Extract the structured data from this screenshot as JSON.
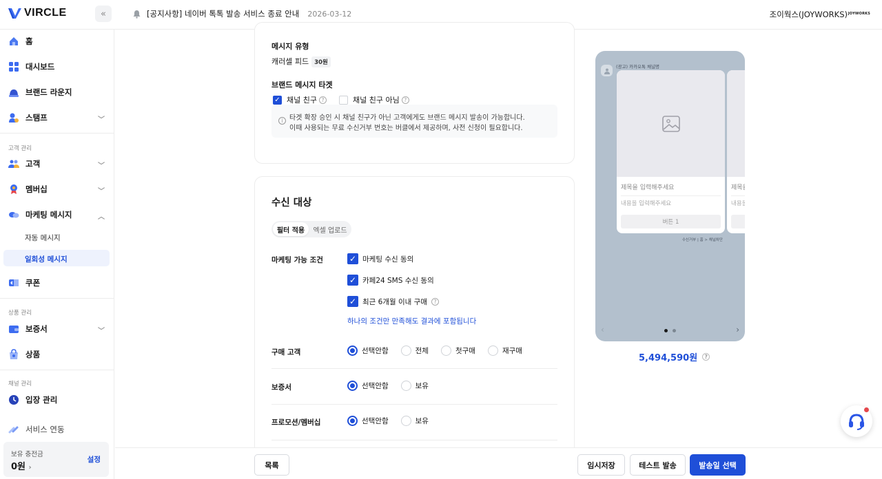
{
  "colors": {
    "accent": "#1f4fd8",
    "preview_bg": "#b3c0cd",
    "badge": "#e5484d"
  },
  "brand": {
    "name": "VIRCLE"
  },
  "header": {
    "notice_title": "[공지사항] 네이버 톡톡 발송 서비스 종료 안내",
    "notice_date": "2026-03-12",
    "user_name": "조이웍스(JOYWORKS)",
    "company_logo": "JOYWORKS"
  },
  "sidebar": {
    "items": [
      {
        "label": "홈",
        "icon": "home-icon"
      },
      {
        "label": "대시보드",
        "icon": "dashboard-icon"
      },
      {
        "label": "브랜드 라운지",
        "icon": "lounge-icon"
      },
      {
        "label": "스탬프",
        "icon": "stamp-icon"
      }
    ],
    "section_customer": "고객 관리",
    "customer_items": [
      {
        "label": "고객"
      },
      {
        "label": "멤버십"
      },
      {
        "label": "마케팅 메시지"
      }
    ],
    "sub_items": [
      "자동 메시지",
      "일회성 메시지"
    ],
    "coupon": "쿠폰",
    "section_product": "상품 관리",
    "product_items": [
      "보증서",
      "상품"
    ],
    "section_channel": "채널 관리",
    "channel_items": [
      "입장 관리",
      "서비스 연동"
    ],
    "balance_label": "보유 충전금",
    "balance_amount": "0원",
    "balance_setting": "설정"
  },
  "message_type": {
    "title": "메시지 유형",
    "value": "캐러셀 피드",
    "price": "30원"
  },
  "brand_target": {
    "title": "브랜드 메시지 타겟",
    "option_friend": "채널 친구",
    "option_non_friend": "채널 친구 아님",
    "info_line1": "타겟 확장 승인 시 채널 친구가 아닌 고객에게도 브랜드 메시지 발송이 가능합니다.",
    "info_line2": "이때 사용되는 무료 수신거부 번호는 버클에서 제공하며, 사전 신청이 필요합니다."
  },
  "recipients": {
    "title": "수신 대상",
    "tab_filter": "필터 적용",
    "tab_excel": "엑셀 업로드",
    "marketing_label": "마케팅 가능 조건",
    "conditions": [
      "마케팅 수신 동의",
      "카페24 SMS 수신 동의",
      "최근 6개월 이내 구매"
    ],
    "condition_note": "하나의 조건만 만족해도 결과에 포함됩니다",
    "purchase_label": "구매 고객",
    "purchase_options": [
      "선택안함",
      "전체",
      "첫구매",
      "재구매"
    ],
    "warranty_label": "보증서",
    "warranty_options": [
      "선택안함",
      "보유"
    ],
    "promo_label": "프로모션/멤버십",
    "promo_options": [
      "선택안함",
      "보유"
    ]
  },
  "preview": {
    "channel_name": "(광고) 카카오톡 채널명",
    "card_title_placeholder": "제목을 입력해주세요",
    "card_body_placeholder": "내용을 입력해주세요",
    "card_button": "버튼 1",
    "card2_title_partial": "제목을",
    "card2_body_partial": "내용을",
    "footnote": "수신거부 | 홈 > 채널차단",
    "total_price": "5,494,590원"
  },
  "actions": {
    "list": "목록",
    "draft": "임시저장",
    "test_send": "테스트 발송",
    "choose_date": "발송일 선택"
  }
}
